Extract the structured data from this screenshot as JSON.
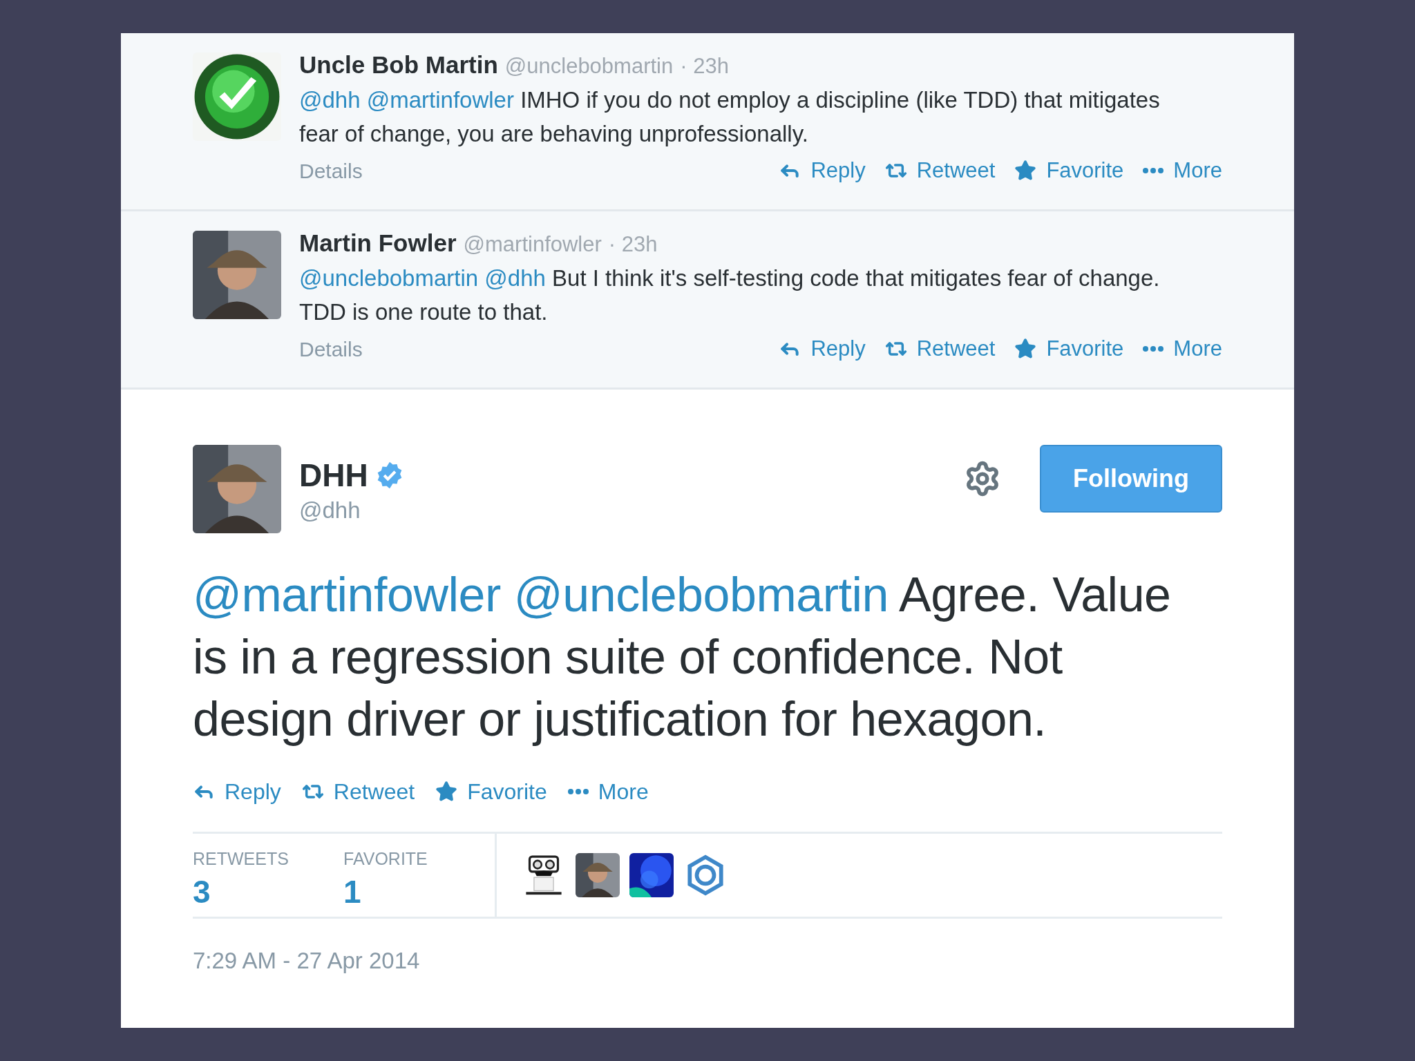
{
  "replies": [
    {
      "name": "Uncle Bob Martin",
      "handle": "@unclebobmartin",
      "time": "· 23h",
      "body": [
        {
          "kind": "mention",
          "text": "@dhh"
        },
        {
          "kind": "mention",
          "text": "@martinfowler"
        },
        {
          "kind": "text",
          "text": "IMHO if you do not employ a discipline (like TDD) that mitigates fear of change, you are behaving unprofessionally."
        }
      ],
      "details": "Details",
      "actions": [
        {
          "kind": "reply",
          "label": "Reply"
        },
        {
          "kind": "retweet",
          "label": "Retweet"
        },
        {
          "kind": "favorite",
          "label": "Favorite"
        },
        {
          "kind": "more",
          "label": "More"
        }
      ]
    },
    {
      "name": "Martin Fowler",
      "handle": "@martinfowler",
      "time": "· 23h",
      "body": [
        {
          "kind": "mention",
          "text": "@unclebobmartin"
        },
        {
          "kind": "mention",
          "text": "@dhh"
        },
        {
          "kind": "text",
          "text": "But I think it's self-testing code that mitigates fear of change. TDD is one route to that."
        }
      ],
      "details": "Details",
      "actions": [
        {
          "kind": "reply",
          "label": "Reply"
        },
        {
          "kind": "retweet",
          "label": "Retweet"
        },
        {
          "kind": "favorite",
          "label": "Favorite"
        },
        {
          "kind": "more",
          "label": "More"
        }
      ]
    }
  ],
  "tweet": {
    "name": "DHH",
    "verified": true,
    "handle": "@dhh",
    "follow_button": "Following",
    "body": [
      {
        "kind": "mention",
        "text": "@martinfowler"
      },
      {
        "kind": "mention",
        "text": "@unclebobmartin"
      },
      {
        "kind": "text",
        "text": "Agree. Value is in a regression suite of confidence. Not design driver or justification for hexagon."
      }
    ],
    "actions": [
      {
        "kind": "reply",
        "label": "Reply"
      },
      {
        "kind": "retweet",
        "label": "Retweet"
      },
      {
        "kind": "favorite",
        "label": "Favorite"
      },
      {
        "kind": "more",
        "label": "More"
      }
    ],
    "stats": [
      {
        "label": "RETWEETS",
        "value": "3"
      },
      {
        "label": "FAVORITE",
        "value": "1"
      }
    ],
    "timestamp": "7:29 AM - 27 Apr 2014"
  }
}
